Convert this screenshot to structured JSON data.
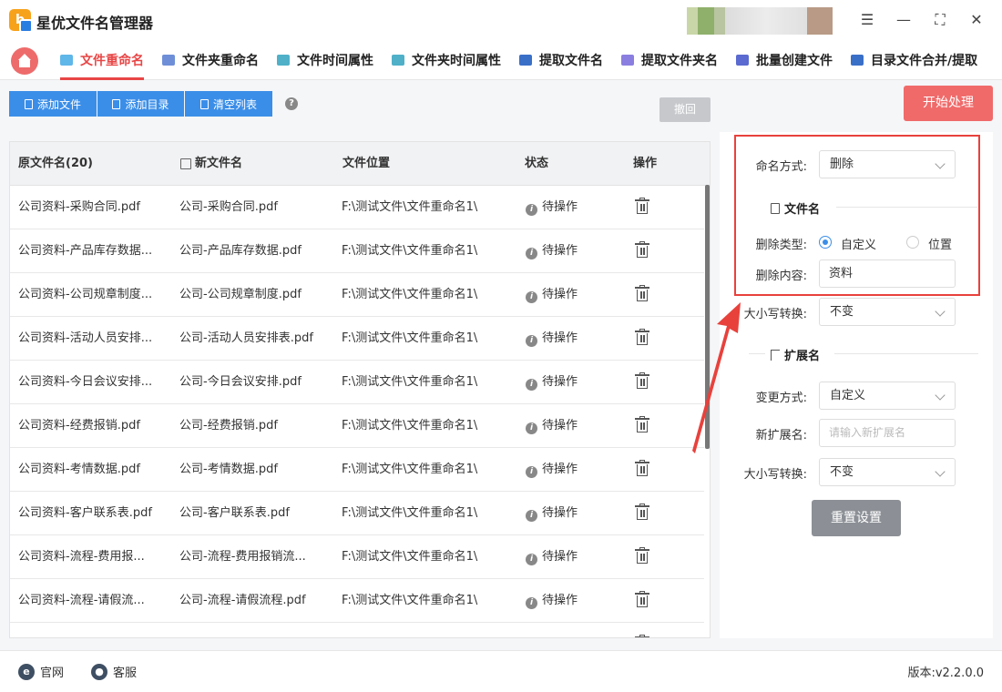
{
  "app": {
    "title": "星优文件名管理器"
  },
  "tabs": [
    {
      "label": "文件重命名",
      "active": true
    },
    {
      "label": "文件夹重命名"
    },
    {
      "label": "文件时间属性"
    },
    {
      "label": "文件夹时间属性"
    },
    {
      "label": "提取文件名"
    },
    {
      "label": "提取文件夹名"
    },
    {
      "label": "批量创建文件"
    },
    {
      "label": "目录文件合并/提取"
    }
  ],
  "toolbar": {
    "add_file": "添加文件",
    "add_dir": "添加目录",
    "clear_list": "清空列表",
    "help": "?",
    "undo": "撤回",
    "start": "开始处理"
  },
  "table": {
    "headers": {
      "original": "原文件名(20)",
      "new": "新文件名",
      "location": "文件位置",
      "status": "状态",
      "action": "操作"
    },
    "rows": [
      {
        "original": "公司资料-采购合同.pdf",
        "new": "公司-采购合同.pdf",
        "location": "F:\\测试文件\\文件重命名1\\",
        "status": "待操作"
      },
      {
        "original": "公司资料-产品库存数据...",
        "new": "公司-产品库存数据.pdf",
        "location": "F:\\测试文件\\文件重命名1\\",
        "status": "待操作"
      },
      {
        "original": "公司资料-公司规章制度...",
        "new": "公司-公司规章制度.pdf",
        "location": "F:\\测试文件\\文件重命名1\\",
        "status": "待操作"
      },
      {
        "original": "公司资料-活动人员安排...",
        "new": "公司-活动人员安排表.pdf",
        "location": "F:\\测试文件\\文件重命名1\\",
        "status": "待操作"
      },
      {
        "original": "公司资料-今日会议安排...",
        "new": "公司-今日会议安排.pdf",
        "location": "F:\\测试文件\\文件重命名1\\",
        "status": "待操作"
      },
      {
        "original": "公司资料-经费报销.pdf",
        "new": "公司-经费报销.pdf",
        "location": "F:\\测试文件\\文件重命名1\\",
        "status": "待操作"
      },
      {
        "original": "公司资料-考情数据.pdf",
        "new": "公司-考情数据.pdf",
        "location": "F:\\测试文件\\文件重命名1\\",
        "status": "待操作"
      },
      {
        "original": "公司资料-客户联系表.pdf",
        "new": "公司-客户联系表.pdf",
        "location": "F:\\测试文件\\文件重命名1\\",
        "status": "待操作"
      },
      {
        "original": "公司资料-流程-费用报...",
        "new": "公司-流程-费用报销流...",
        "location": "F:\\测试文件\\文件重命名1\\",
        "status": "待操作"
      },
      {
        "original": "公司资料-流程-请假流...",
        "new": "公司-流程-请假流程.pdf",
        "location": "F:\\测试文件\\文件重命名1\\",
        "status": "待操作"
      }
    ]
  },
  "panel": {
    "naming_method_label": "命名方式:",
    "naming_method_value": "删除",
    "filename_section": "文件名",
    "delete_type_label": "删除类型:",
    "delete_type_custom": "自定义",
    "delete_type_position": "位置",
    "delete_content_label": "删除内容:",
    "delete_content_value": "资料",
    "case_label": "大小写转换:",
    "case_value": "不变",
    "ext_section": "扩展名",
    "change_method_label": "变更方式:",
    "change_method_value": "自定义",
    "new_ext_label": "新扩展名:",
    "new_ext_placeholder": "请输入新扩展名",
    "ext_case_label": "大小写转换:",
    "ext_case_value": "不变",
    "reset": "重置设置"
  },
  "statusbar": {
    "website": "官网",
    "service": "客服",
    "version": "版本:v2.2.0.0"
  },
  "colors": {
    "accent": "#e84646",
    "primary": "#3b8ee8",
    "highlight_box": "#e8413c"
  }
}
